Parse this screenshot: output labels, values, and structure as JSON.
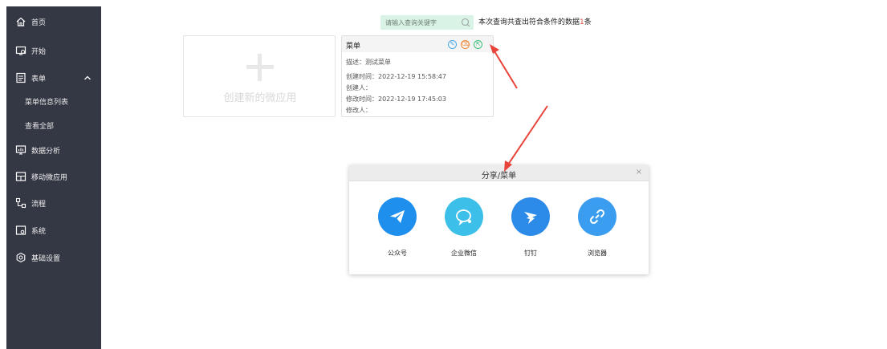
{
  "sidebar": {
    "items": [
      {
        "label": "首页",
        "icon": "home-icon"
      },
      {
        "label": "开始",
        "icon": "start-icon"
      },
      {
        "label": "表单",
        "icon": "form-icon"
      },
      {
        "label": "数据分析",
        "icon": "data-analysis-icon"
      },
      {
        "label": "移动微应用",
        "icon": "mobile-app-icon"
      },
      {
        "label": "流程",
        "icon": "flow-icon"
      },
      {
        "label": "系统",
        "icon": "system-icon"
      },
      {
        "label": "基础设置",
        "icon": "settings-icon"
      }
    ],
    "sub_items": [
      {
        "label": "菜单信息列表"
      },
      {
        "label": "查看全部"
      }
    ],
    "background": "#343744"
  },
  "search": {
    "placeholder": "请输入查询关键字",
    "result_prefix": "本次查询共查出符合条件的数据",
    "result_count": "1",
    "result_suffix": "条"
  },
  "create_card": {
    "label": "创建新的微应用"
  },
  "menu_card": {
    "title": "菜单",
    "actions": [
      {
        "name": "edit",
        "color": "#48a9e6",
        "symbol": "✎"
      },
      {
        "name": "delete",
        "color": "#f08a3c",
        "symbol": "⌫"
      },
      {
        "name": "share",
        "color": "#3cbf7a",
        "symbol": "⇱"
      }
    ],
    "description": "描述：测试菜单",
    "created_time": "创建时间：2022-12-19 15:58:47",
    "creator": "创建人：",
    "modified_time": "修改时间：2022-12-19 17:45:03",
    "modifier": "修改人："
  },
  "dialog": {
    "title": "分享/菜单",
    "close": "×",
    "options": [
      {
        "label": "公众号",
        "color": "#1e8fec",
        "icon": "paper-plane-icon"
      },
      {
        "label": "企业微信",
        "color": "#3cc0ea",
        "icon": "wecom-icon"
      },
      {
        "label": "钉钉",
        "color": "#2c8ae8",
        "icon": "dingtalk-icon"
      },
      {
        "label": "浏览器",
        "color": "#3a9df0",
        "icon": "link-icon"
      }
    ]
  },
  "annotation_color": "#e8443a"
}
